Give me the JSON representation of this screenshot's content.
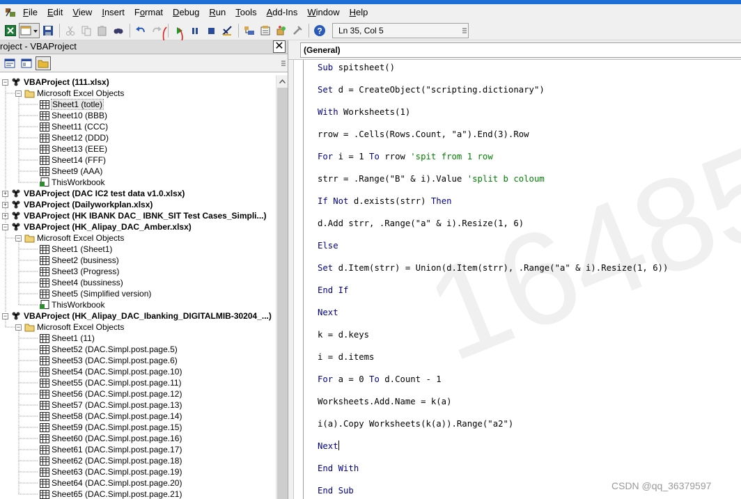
{
  "menu": {
    "items": [
      {
        "label": "File",
        "u": "F",
        "rest": "ile"
      },
      {
        "label": "Edit",
        "u": "E",
        "rest": "dit"
      },
      {
        "label": "View",
        "u": "V",
        "rest": "iew"
      },
      {
        "label": "Insert",
        "u": "I",
        "rest": "nsert"
      },
      {
        "label": "Format",
        "pre": "F",
        "u": "o",
        "rest": "rmat"
      },
      {
        "label": "Debug",
        "u": "D",
        "rest": "ebug"
      },
      {
        "label": "Run",
        "u": "R",
        "rest": "un"
      },
      {
        "label": "Tools",
        "u": "T",
        "rest": "ools"
      },
      {
        "label": "Add-Ins",
        "u": "A",
        "rest": "dd-Ins"
      },
      {
        "label": "Window",
        "u": "W",
        "rest": "indow"
      },
      {
        "label": "Help",
        "u": "H",
        "rest": "elp"
      }
    ]
  },
  "toolbar": {
    "status": "Ln 35, Col 5",
    "icons": [
      "excel-view-icon",
      "insert-module-icon",
      "save-icon",
      "cut-icon",
      "copy-icon",
      "paste-icon",
      "find-icon",
      "undo-icon",
      "redo-icon",
      "run-icon",
      "break-icon",
      "reset-icon",
      "design-mode-icon",
      "project-explorer-icon",
      "properties-icon",
      "object-browser-icon",
      "toolbox-icon",
      "help-icon"
    ]
  },
  "project_pane": {
    "title": "roject - VBAProject",
    "tree": [
      {
        "level": 0,
        "kind": "project",
        "expander": "-",
        "label": "VBAProject (111.xlsx)"
      },
      {
        "level": 1,
        "kind": "folder",
        "expander": "-",
        "label": "Microsoft Excel Objects"
      },
      {
        "level": 2,
        "kind": "sheet",
        "label": "Sheet1 (totle)",
        "selected": true
      },
      {
        "level": 2,
        "kind": "sheet",
        "label": "Sheet10 (BBB)"
      },
      {
        "level": 2,
        "kind": "sheet",
        "label": "Sheet11 (CCC)"
      },
      {
        "level": 2,
        "kind": "sheet",
        "label": "Sheet12 (DDD)"
      },
      {
        "level": 2,
        "kind": "sheet",
        "label": "Sheet13 (EEE)"
      },
      {
        "level": 2,
        "kind": "sheet",
        "label": "Sheet14 (FFF)"
      },
      {
        "level": 2,
        "kind": "sheet",
        "label": "Sheet9 (AAA)"
      },
      {
        "level": 2,
        "kind": "workbook",
        "label": "ThisWorkbook"
      },
      {
        "level": 0,
        "kind": "project",
        "expander": "+",
        "label": "VBAProject (DAC IC2 test data v1.0.xlsx)"
      },
      {
        "level": 0,
        "kind": "project",
        "expander": "+",
        "label": "VBAProject (Dailyworkplan.xlsx)"
      },
      {
        "level": 0,
        "kind": "project",
        "expander": "+",
        "label": "VBAProject (HK IBANK DAC_ IBNK_SIT Test Cases_Simpli...)"
      },
      {
        "level": 0,
        "kind": "project",
        "expander": "-",
        "label": "VBAProject (HK_Alipay_DAC_Amber.xlsx)"
      },
      {
        "level": 1,
        "kind": "folder",
        "expander": "-",
        "label": "Microsoft Excel Objects"
      },
      {
        "level": 2,
        "kind": "sheet",
        "label": "Sheet1 (Sheet1)"
      },
      {
        "level": 2,
        "kind": "sheet",
        "label": "Sheet2 (business)"
      },
      {
        "level": 2,
        "kind": "sheet",
        "label": "Sheet3 (Progress)"
      },
      {
        "level": 2,
        "kind": "sheet",
        "label": "Sheet4 (bussiness)"
      },
      {
        "level": 2,
        "kind": "sheet",
        "label": "Sheet5 (Simplified version)"
      },
      {
        "level": 2,
        "kind": "workbook",
        "label": "ThisWorkbook"
      },
      {
        "level": 0,
        "kind": "project",
        "expander": "-",
        "label": "VBAProject (HK_Alipay_DAC_Ibanking_DIGITALMIB-30204_...)"
      },
      {
        "level": 1,
        "kind": "folder",
        "expander": "-",
        "label": "Microsoft Excel Objects"
      },
      {
        "level": 2,
        "kind": "sheet",
        "label": "Sheet1 (11)"
      },
      {
        "level": 2,
        "kind": "sheet",
        "label": "Sheet52 (DAC.Simpl.post.page.5)"
      },
      {
        "level": 2,
        "kind": "sheet",
        "label": "Sheet53 (DAC.Simpl.post.page.6)"
      },
      {
        "level": 2,
        "kind": "sheet",
        "label": "Sheet54 (DAC.Simpl.post.page.10)"
      },
      {
        "level": 2,
        "kind": "sheet",
        "label": "Sheet55 (DAC.Simpl.post.page.11)"
      },
      {
        "level": 2,
        "kind": "sheet",
        "label": "Sheet56 (DAC.Simpl.post.page.12)"
      },
      {
        "level": 2,
        "kind": "sheet",
        "label": "Sheet57 (DAC.Simpl.post.page.13)"
      },
      {
        "level": 2,
        "kind": "sheet",
        "label": "Sheet58 (DAC.Simpl.post.page.14)"
      },
      {
        "level": 2,
        "kind": "sheet",
        "label": "Sheet59 (DAC.Simpl.post.page.15)"
      },
      {
        "level": 2,
        "kind": "sheet",
        "label": "Sheet60 (DAC.Simpl.post.page.16)"
      },
      {
        "level": 2,
        "kind": "sheet",
        "label": "Sheet61 (DAC.Simpl.post.page.17)"
      },
      {
        "level": 2,
        "kind": "sheet",
        "label": "Sheet62 (DAC.Simpl.post.page.18)"
      },
      {
        "level": 2,
        "kind": "sheet",
        "label": "Sheet63 (DAC.Simpl.post.page.19)"
      },
      {
        "level": 2,
        "kind": "sheet",
        "label": "Sheet64 (DAC.Simpl.post.page.20)"
      },
      {
        "level": 2,
        "kind": "sheet",
        "label": "Sheet65 (DAC.Simpl.post.page.21)"
      }
    ]
  },
  "code_window": {
    "object_combo": "(General)",
    "lines": [
      [
        {
          "t": "Sub",
          "c": "kw"
        },
        {
          "t": " spitsheet()"
        }
      ],
      [
        {
          "t": "Set",
          "c": "kw"
        },
        {
          "t": " d = CreateObject(\"scripting.dictionary\")"
        }
      ],
      [
        {
          "t": "With",
          "c": "kw"
        },
        {
          "t": " Worksheets(1)"
        }
      ],
      [
        {
          "t": "rrow = .Cells(Rows.Count, \"a\").End(3).Row"
        }
      ],
      [
        {
          "t": "For",
          "c": "kw"
        },
        {
          "t": " i = 1 "
        },
        {
          "t": "To",
          "c": "kw"
        },
        {
          "t": " rrow "
        },
        {
          "t": "'spit from 1 row",
          "c": "cm"
        }
      ],
      [
        {
          "t": "strr = .Range(\"B\" & i).Value "
        },
        {
          "t": "'split b coloum",
          "c": "cm"
        }
      ],
      [
        {
          "t": "If",
          "c": "kw"
        },
        {
          "t": " "
        },
        {
          "t": "Not",
          "c": "kw"
        },
        {
          "t": " d.exists(strr) "
        },
        {
          "t": "Then",
          "c": "kw"
        }
      ],
      [
        {
          "t": "d.Add strr, .Range(\"a\" & i).Resize(1, 6)"
        }
      ],
      [
        {
          "t": "Else",
          "c": "kw"
        }
      ],
      [
        {
          "t": "Set",
          "c": "kw"
        },
        {
          "t": " d.Item(strr) = Union(d.Item(strr), .Range(\"a\" & i).Resize(1, 6))"
        }
      ],
      [
        {
          "t": "End If",
          "c": "kw"
        }
      ],
      [
        {
          "t": "Next",
          "c": "kw"
        }
      ],
      [
        {
          "t": "k = d.keys"
        }
      ],
      [
        {
          "t": "i = d.items"
        }
      ],
      [
        {
          "t": "For",
          "c": "kw"
        },
        {
          "t": " a = 0 "
        },
        {
          "t": "To",
          "c": "kw"
        },
        {
          "t": " d.Count - 1"
        }
      ],
      [
        {
          "t": "Worksheets.Add.Name = k(a)"
        }
      ],
      [
        {
          "t": "i(a).Copy Worksheets(k(a)).Range(\"a2\")"
        }
      ],
      [
        {
          "t": "Next",
          "c": "kw",
          "caret": true
        }
      ],
      [
        {
          "t": "End With",
          "c": "kw"
        }
      ],
      [
        {
          "t": "End Sub",
          "c": "kw"
        }
      ]
    ]
  },
  "watermarks": {
    "big_number": "16485",
    "csdn": "CSDN @qq_36379597"
  },
  "colors": {
    "keyword": "#00008b",
    "comment": "#008000",
    "title_bar": "#1d6fd6",
    "annotation": "#e0201b"
  }
}
